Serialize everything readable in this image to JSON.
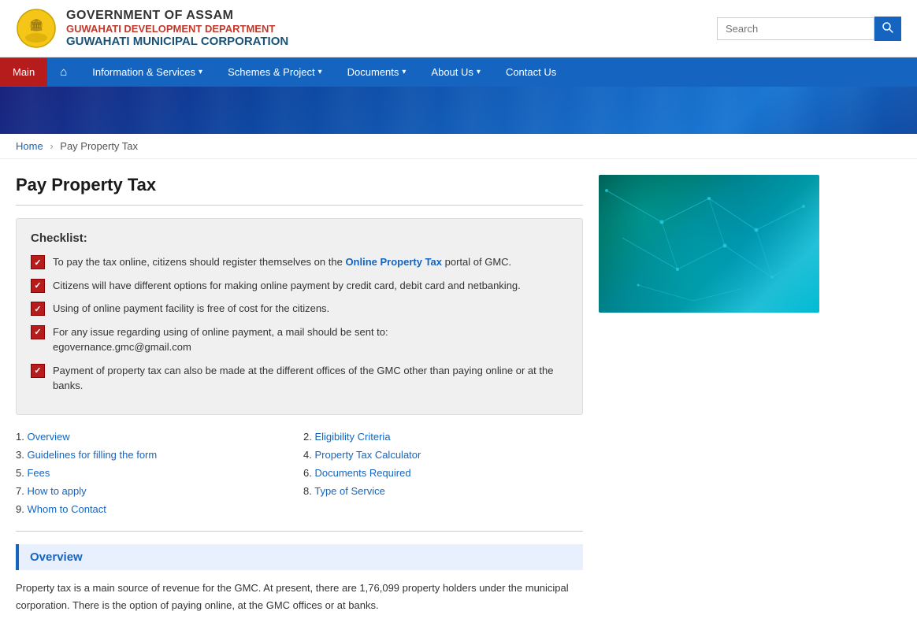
{
  "header": {
    "gov_name": "GOVERNMENT OF ASSAM",
    "dept_name": "GUWAHATI DEVELOPMENT DEPARTMENT",
    "corp_name": "GUWAHATI MUNICIPAL CORPORATION",
    "search_placeholder": "Search"
  },
  "navbar": {
    "items": [
      {
        "label": "Main",
        "active": true,
        "has_caret": false,
        "is_home": false
      },
      {
        "label": "🏠",
        "active": false,
        "has_caret": false,
        "is_home": true
      },
      {
        "label": "Information & Services",
        "active": false,
        "has_caret": true,
        "is_home": false
      },
      {
        "label": "Schemes & Project",
        "active": false,
        "has_caret": true,
        "is_home": false
      },
      {
        "label": "Documents",
        "active": false,
        "has_caret": true,
        "is_home": false
      },
      {
        "label": "About Us",
        "active": false,
        "has_caret": true,
        "is_home": false
      },
      {
        "label": "Contact Us",
        "active": false,
        "has_caret": false,
        "is_home": false
      }
    ]
  },
  "breadcrumb": {
    "home": "Home",
    "separator": "›",
    "current": "Pay Property Tax"
  },
  "page_title": "Pay Property Tax",
  "checklist": {
    "title": "Checklist:",
    "items": [
      {
        "text_before": "To pay the tax online, citizens should register themselves on the ",
        "link_text": "Online Property Tax",
        "text_after": " portal of GMC."
      },
      {
        "text_only": "Citizens will have different options for making online payment by credit card, debit card and netbanking."
      },
      {
        "text_only": "Using of online payment facility is free of cost for the citizens."
      },
      {
        "text_only": "For any issue regarding using of online payment, a mail should be sent to: egovernance.gmc@gmail.com"
      },
      {
        "text_only": "Payment of property tax can also be made at the different offices of the GMC other than paying online or at the banks."
      }
    ]
  },
  "links": [
    {
      "number": "1.",
      "label": "Overview"
    },
    {
      "number": "2.",
      "label": "Eligibility Criteria"
    },
    {
      "number": "3.",
      "label": "Guidelines for filling the form"
    },
    {
      "number": "4.",
      "label": "Property Tax Calculator"
    },
    {
      "number": "5.",
      "label": "Fees"
    },
    {
      "number": "6.",
      "label": "Documents Required"
    },
    {
      "number": "7.",
      "label": "How to apply"
    },
    {
      "number": "8.",
      "label": "Type of Service"
    },
    {
      "number": "9.",
      "label": "Whom to Contact"
    }
  ],
  "overview": {
    "section_label": "Overview",
    "text": "Property tax is a main source of revenue for the GMC. At present, there are 1,76,099 property holders under the municipal corporation. There is the option of paying online, at the GMC offices or at banks."
  }
}
